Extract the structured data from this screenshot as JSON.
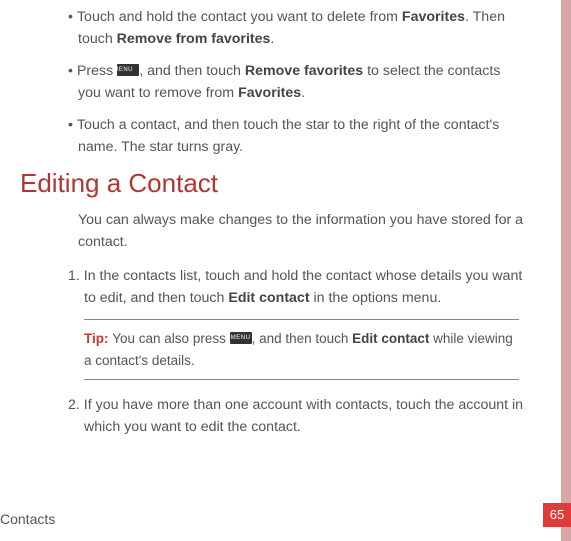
{
  "bullets": {
    "b1_pre": "Touch and hold the contact you want to delete from ",
    "b1_bold1": "Favorites",
    "b1_mid": ". Then touch ",
    "b1_bold2": "Remove from favorites",
    "b1_post": ".",
    "b2_pre": "Press ",
    "b2_mid": ", and then touch ",
    "b2_bold1": "Remove favorites",
    "b2_mid2": " to select the contacts you want to remove from ",
    "b2_bold2": "Favorites",
    "b2_post": ".",
    "b3": "Touch a contact, and then touch the star to the right of the contact's name. The star turns gray."
  },
  "heading": "Editing a Contact",
  "intro": "You can always make changes to the information you have stored for a contact.",
  "steps": {
    "s1_pre": "1. In the contacts list, touch and hold the contact whose details you want to edit, and then touch ",
    "s1_bold": "Edit contact",
    "s1_post": " in the options menu.",
    "s2": "2. If you have more than one account with contacts, touch the account in which you want to edit the contact."
  },
  "tip": {
    "label": "Tip:  ",
    "pre": "You can also press ",
    "mid": ", and then touch ",
    "bold": "Edit contact",
    "post": " while viewing a contact's details."
  },
  "menu_icon_text": "MENU",
  "footer": "Contacts",
  "page_number": "65"
}
